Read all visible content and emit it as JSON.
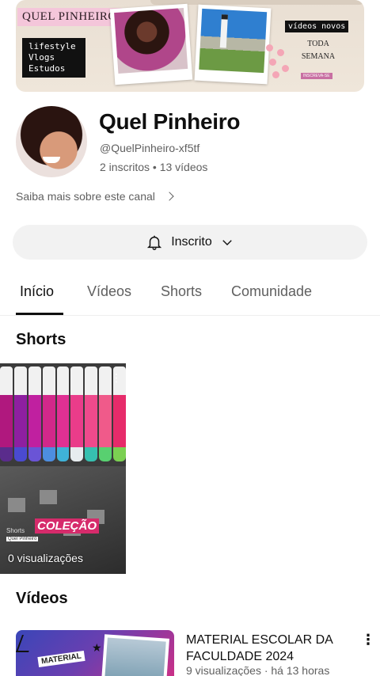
{
  "banner": {
    "brand": "QUEL PINHEIRO",
    "tags": [
      "lifestyle",
      "Vlogs",
      "Estudos"
    ],
    "new_videos": "vídeos novos",
    "weekly": [
      "TODA",
      "SEMANA"
    ],
    "subscribe_tag": "INSCREVA-SE"
  },
  "channel": {
    "name": "Quel Pinheiro",
    "handle": "@QuelPinheiro-xf5tf",
    "stats": "2 inscritos • 13 vídeos",
    "about_link": "Saiba mais sobre este canal",
    "subscribe_label": "Inscrito",
    "avatar_icon": "avatar"
  },
  "tabs": [
    {
      "label": "Início",
      "active": true
    },
    {
      "label": "Vídeos",
      "active": false
    },
    {
      "label": "Shorts",
      "active": false
    },
    {
      "label": "Comunidade",
      "active": false
    }
  ],
  "shorts_section": {
    "title": "Shorts",
    "items": [
      {
        "overlay": "COLEÇÃO",
        "channel_tag": "Shorts",
        "owner": "Quel Pinheiro",
        "views": "0 visualizações"
      }
    ]
  },
  "videos_section": {
    "title": "Vídeos",
    "items": [
      {
        "title": "MATERIAL ESCOLAR DA FACULDADE 2024",
        "meta": "9 visualizações · há 13 horas",
        "thumb_label": "MATERIAL"
      }
    ]
  },
  "colors": {
    "accent_pink": "#d62b6b",
    "tab_active": "#0f0f0f",
    "muted_text": "#606060",
    "button_bg": "#f2f2f2"
  },
  "icons": [
    "bell-icon",
    "chevron-down-icon",
    "chevron-right-icon",
    "more-vert-icon"
  ]
}
